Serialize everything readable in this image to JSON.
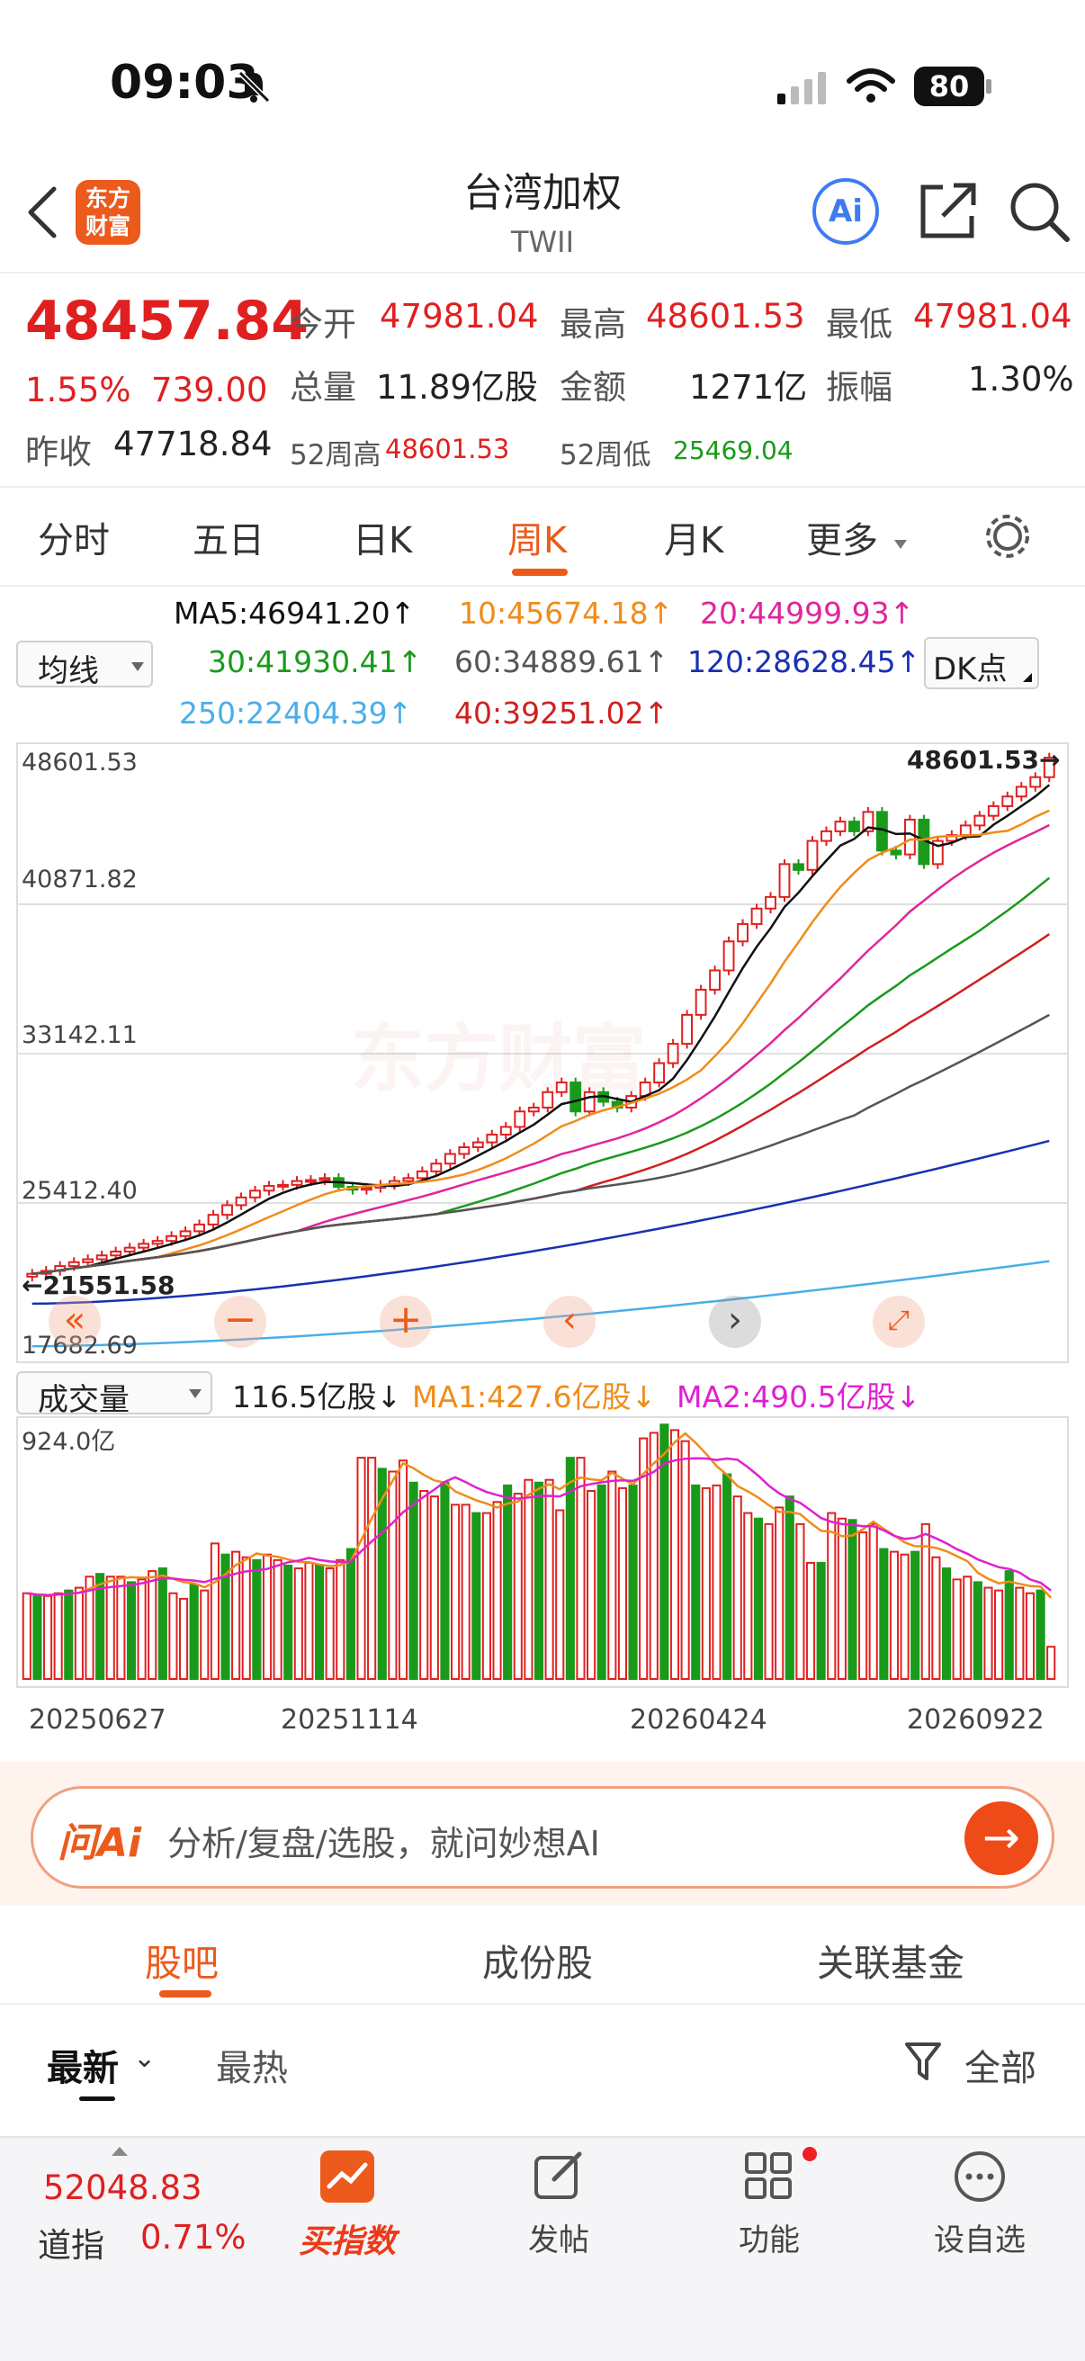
{
  "status_bar": {
    "time": "09:03",
    "battery": "80"
  },
  "header": {
    "title": "台湾加权",
    "subtitle": "TWII",
    "logo_text_1": "东方",
    "logo_text_2": "财富",
    "ai_label": "Ai"
  },
  "quote": {
    "price": "48457.84",
    "change_pct": "1.55%",
    "change": "739.00",
    "prev_close_label": "昨收",
    "prev_close": "47718.84",
    "open_label": "今开",
    "open": "47981.04",
    "high_label": "最高",
    "high": "48601.53",
    "low_label": "最低",
    "low": "47981.04",
    "volume_label": "总量",
    "volume": "11.89亿股",
    "amount_label": "金额",
    "amount": "1271亿",
    "amplitude_label": "振幅",
    "amplitude": "1.30%",
    "wk52_high_label": "52周高",
    "wk52_high": "48601.53",
    "wk52_low_label": "52周低",
    "wk52_low": "25469.04"
  },
  "tabs": {
    "items": [
      "分时",
      "五日",
      "日K",
      "周K",
      "月K",
      "更多"
    ],
    "active": "周K"
  },
  "indicators": {
    "ma_select": "均线",
    "dk": "DK点",
    "ma5": "MA5:46941.20↑",
    "ma10": "10:45674.18↑",
    "ma20": "20:44999.93↑",
    "ma30": "30:41930.41↑",
    "ma60": "60:34889.61↑",
    "ma120": "120:28628.45↑",
    "ma250": "250:22404.39↑",
    "ma40": "40:39251.02↑"
  },
  "colors": {
    "up": "#e02020",
    "down": "#1a9a1a",
    "ma5": "#111111",
    "ma10": "#f08c1a",
    "ma20": "#e0259a",
    "ma30": "#1a9a1a",
    "ma40": "#d02020",
    "ma60": "#555555",
    "ma120": "#1a30b0",
    "ma250": "#4aaee8",
    "accent": "#ec5a1c"
  },
  "chart_data": [
    {
      "type": "candlestick",
      "title": "台湾加权 周K",
      "y_ticks": [
        "48601.53",
        "40871.82",
        "33142.11",
        "25412.40",
        "17682.69"
      ],
      "ylim": [
        17682.69,
        48601.53
      ],
      "max_marker": "48601.53→",
      "min_marker": "←21551.58",
      "close_approx": [
        21750,
        21900,
        22150,
        22350,
        22500,
        22700,
        22900,
        23100,
        23300,
        23450,
        23700,
        23950,
        24300,
        24800,
        25300,
        25700,
        26050,
        26300,
        26350,
        26550,
        26600,
        26700,
        26250,
        26100,
        26200,
        26350,
        26550,
        26700,
        27050,
        27450,
        27950,
        28300,
        28550,
        28950,
        29350,
        30150,
        30350,
        31150,
        31650,
        30150,
        31150,
        30650,
        30350,
        30950,
        31650,
        32650,
        33650,
        35150,
        36450,
        37450,
        38950,
        39850,
        40650,
        41250,
        42950,
        42650,
        44150,
        44650,
        45150,
        44650,
        45650,
        43650,
        43450,
        45250,
        42950,
        44150,
        44450,
        44950,
        45450,
        45950,
        46450,
        46950,
        47450,
        48458
      ],
      "ma_series": [
        {
          "name": "MA5",
          "last": 46941.2
        },
        {
          "name": "MA10",
          "last": 45674.18
        },
        {
          "name": "MA20",
          "last": 44999.93
        },
        {
          "name": "MA30",
          "last": 41930.41
        },
        {
          "name": "MA40",
          "last": 39251.02
        },
        {
          "name": "MA60",
          "last": 34889.61
        },
        {
          "name": "MA120",
          "last": 28628.45
        },
        {
          "name": "MA250",
          "last": 22404.39
        }
      ]
    },
    {
      "type": "bar",
      "title": "成交量",
      "ylim": [
        0,
        924.0
      ],
      "y_max_label": "924.0亿",
      "x_ticks": [
        "20250627",
        "20251114",
        "20260424",
        "20260922"
      ],
      "values": [
        310,
        300,
        300,
        310,
        320,
        330,
        370,
        380,
        370,
        370,
        350,
        360,
        390,
        400,
        310,
        290,
        340,
        320,
        490,
        450,
        460,
        440,
        430,
        450,
        430,
        410,
        400,
        420,
        410,
        400,
        430,
        470,
        800,
        800,
        760,
        750,
        790,
        710,
        680,
        660,
        710,
        630,
        630,
        600,
        600,
        640,
        700,
        670,
        720,
        710,
        720,
        610,
        800,
        800,
        680,
        700,
        750,
        690,
        700,
        870,
        890,
        920,
        900,
        860,
        700,
        690,
        700,
        740,
        660,
        600,
        580,
        560,
        620,
        660,
        560,
        420,
        420,
        600,
        580,
        575,
        530,
        560,
        470,
        460,
        450,
        460,
        560,
        440,
        400,
        360,
        370,
        350,
        330,
        320,
        390,
        330,
        310,
        320,
        116.5
      ],
      "last": "116.5亿股↓",
      "ma1": "MA1:427.6亿股↓",
      "ma2": "MA2:490.5亿股↓",
      "selector": "成交量"
    }
  ],
  "ask_ai": {
    "logo": "问Ai",
    "placeholder": "分析/复盘/选股，就问妙想AI"
  },
  "bottom_tabs": {
    "guba": "股吧",
    "components": "成份股",
    "funds": "关联基金"
  },
  "feed_sort": {
    "latest": "最新",
    "hot": "最热",
    "filter": "全部"
  },
  "ticker": {
    "value": "52048.83",
    "name": "道指",
    "pct": "0.71%"
  },
  "nav": {
    "buy_index": "买指数",
    "post": "发帖",
    "functions": "功能",
    "watchlist": "设自选"
  }
}
